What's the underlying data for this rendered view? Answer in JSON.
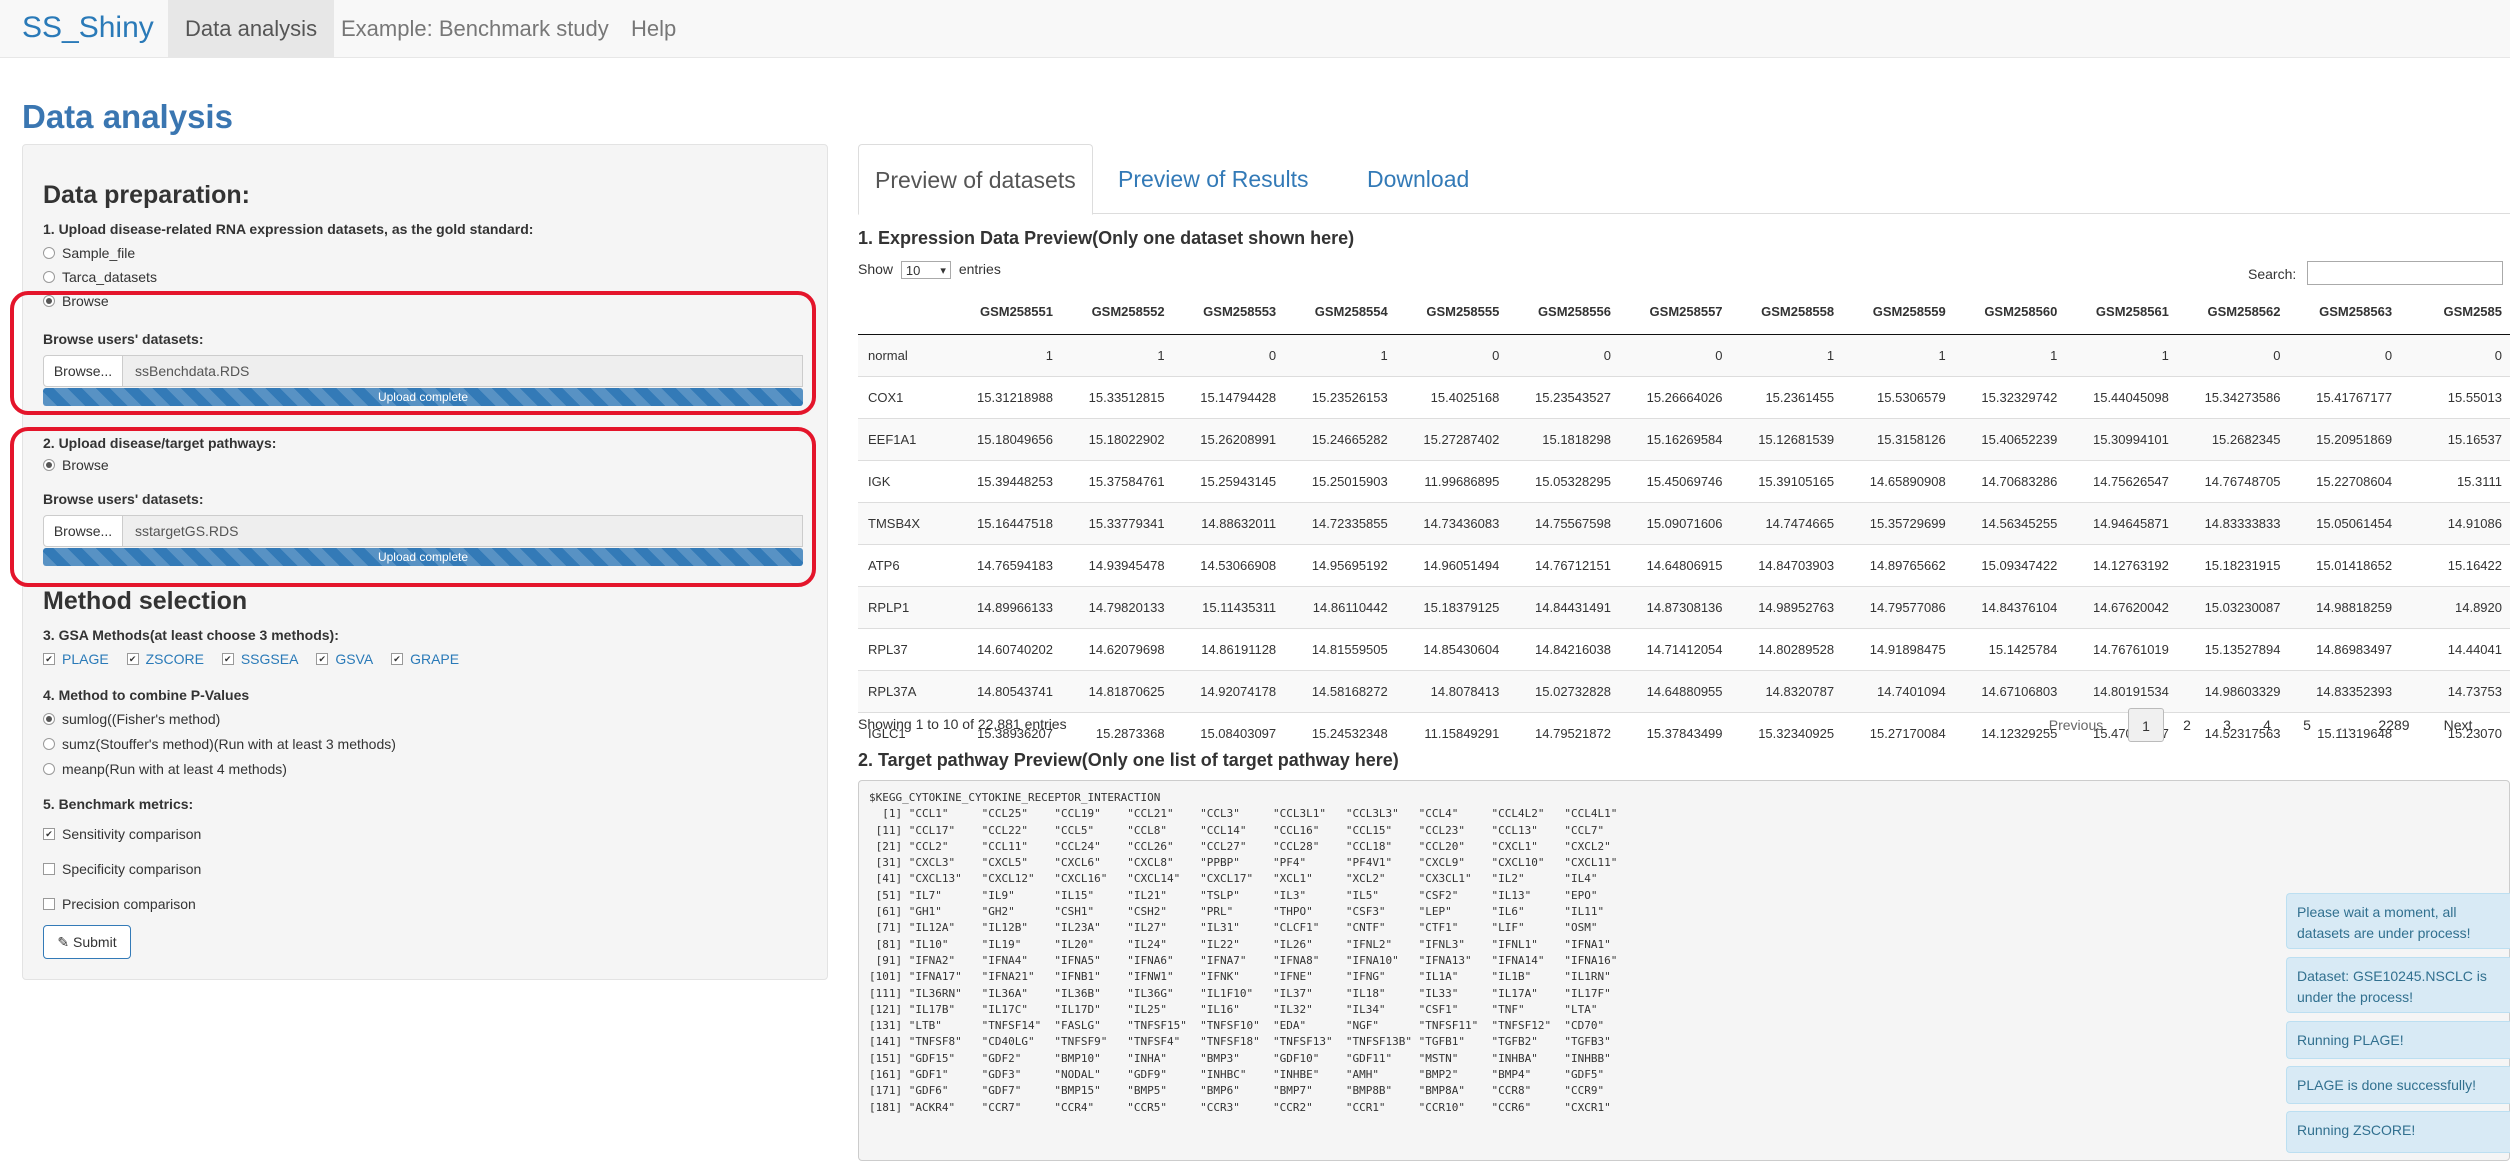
{
  "navbar": {
    "brand": "SS_Shiny",
    "items": [
      {
        "label": "Data analysis",
        "active": true
      },
      {
        "label": "Example: Benchmark study",
        "active": false
      },
      {
        "label": "Help",
        "active": false
      }
    ]
  },
  "page_title": "Data analysis",
  "sidebar": {
    "data_prep_title": "Data preparation:",
    "step1_label": "1. Upload disease-related RNA expression datasets, as the gold standard:",
    "step1_options": [
      {
        "label": "Sample_file",
        "selected": false
      },
      {
        "label": "Tarca_datasets",
        "selected": false
      },
      {
        "label": "Browse",
        "selected": true
      }
    ],
    "browse_users_datasets_1": "Browse users' datasets:",
    "browse_button_1": "Browse...",
    "file_name_1": "ssBenchdata.RDS",
    "upload_status_1": "Upload complete",
    "step2_label": "2. Upload disease/target pathways:",
    "step2_option": {
      "label": "Browse",
      "selected": true
    },
    "browse_users_datasets_2": "Browse users' datasets:",
    "browse_button_2": "Browse...",
    "file_name_2": "sstargetGS.RDS",
    "upload_status_2": "Upload complete",
    "method_title": "Method selection",
    "step3_label": "3. GSA Methods(at least choose 3 methods):",
    "gsa_methods": [
      {
        "label": "PLAGE",
        "checked": true
      },
      {
        "label": "ZSCORE",
        "checked": true
      },
      {
        "label": "SSGSEA",
        "checked": true
      },
      {
        "label": "GSVA",
        "checked": true
      },
      {
        "label": "GRAPE",
        "checked": true
      }
    ],
    "step4_label": "4. Method to combine P-Values",
    "combine_options": [
      {
        "label": "sumlog((Fisher's method)",
        "selected": true
      },
      {
        "label": "sumz(Stouffer's method)(Run with at least 3 methods)",
        "selected": false
      },
      {
        "label": "meanp(Run with at least 4 methods)",
        "selected": false
      }
    ],
    "step5_label": "5. Benchmark metrics:",
    "metrics": [
      {
        "label": "Sensitivity comparison",
        "checked": true
      },
      {
        "label": "Specificity comparison",
        "checked": false
      },
      {
        "label": "Precision comparison",
        "checked": false
      }
    ],
    "submit_label": "Submit"
  },
  "tabs": [
    {
      "label": "Preview of datasets",
      "active": true
    },
    {
      "label": "Preview of Results",
      "active": false
    },
    {
      "label": "Download",
      "active": false
    }
  ],
  "expression": {
    "title": "1. Expression Data Preview(Only one dataset shown here)",
    "show_label": "Show",
    "entries_value": "10",
    "entries_label": "entries",
    "search_label": "Search:",
    "columns": [
      "",
      "GSM258551",
      "GSM258552",
      "GSM258553",
      "GSM258554",
      "GSM258555",
      "GSM258556",
      "GSM258557",
      "GSM258558",
      "GSM258559",
      "GSM258560",
      "GSM258561",
      "GSM258562",
      "GSM258563",
      "GSM2585"
    ],
    "rows": [
      [
        "normal",
        "1",
        "1",
        "0",
        "1",
        "0",
        "0",
        "0",
        "1",
        "1",
        "1",
        "1",
        "0",
        "0",
        "0"
      ],
      [
        "COX1",
        "15.31218988",
        "15.33512815",
        "15.14794428",
        "15.23526153",
        "15.4025168",
        "15.23543527",
        "15.26664026",
        "15.2361455",
        "15.5306579",
        "15.32329742",
        "15.44045098",
        "15.34273586",
        "15.41767177",
        "15.55013"
      ],
      [
        "EEF1A1",
        "15.18049656",
        "15.18022902",
        "15.26208991",
        "15.24665282",
        "15.27287402",
        "15.1818298",
        "15.16269584",
        "15.12681539",
        "15.3158126",
        "15.40652239",
        "15.30994101",
        "15.2682345",
        "15.20951869",
        "15.16537"
      ],
      [
        "IGK",
        "15.39448253",
        "15.37584761",
        "15.25943145",
        "15.25015903",
        "11.99686895",
        "15.05328295",
        "15.45069746",
        "15.39105165",
        "14.65890908",
        "14.70683286",
        "14.75626547",
        "14.76748705",
        "15.22708604",
        "15.3111"
      ],
      [
        "TMSB4X",
        "15.16447518",
        "15.33779341",
        "14.88632011",
        "14.72335855",
        "14.73436083",
        "14.75567598",
        "15.09071606",
        "14.7474665",
        "15.35729699",
        "14.56345255",
        "14.94645871",
        "14.83333833",
        "15.05061454",
        "14.91086"
      ],
      [
        "ATP6",
        "14.76594183",
        "14.93945478",
        "14.53066908",
        "14.95695192",
        "14.96051494",
        "14.76712151",
        "14.64806915",
        "14.84703903",
        "14.89765662",
        "15.09347422",
        "14.12763192",
        "15.18231915",
        "15.01418652",
        "15.16422"
      ],
      [
        "RPLP1",
        "14.89966133",
        "14.79820133",
        "15.11435311",
        "14.86110442",
        "15.18379125",
        "14.84431491",
        "14.87308136",
        "14.98952763",
        "14.79577086",
        "14.84376104",
        "14.67620042",
        "15.03230087",
        "14.98818259",
        "14.8920"
      ],
      [
        "RPL37",
        "14.60740202",
        "14.62079698",
        "14.86191128",
        "14.81559505",
        "14.85430604",
        "14.84216038",
        "14.71412054",
        "14.80289528",
        "14.91898475",
        "15.1425784",
        "14.76761019",
        "15.13527894",
        "14.86983497",
        "14.44041"
      ],
      [
        "RPL37A",
        "14.80543741",
        "14.81870625",
        "14.92074178",
        "14.58168272",
        "14.8078413",
        "15.02732828",
        "14.64880955",
        "14.8320787",
        "14.7401094",
        "14.67106803",
        "14.80191534",
        "14.98603329",
        "14.83352393",
        "14.73753"
      ],
      [
        "IGLC1",
        "15.38936207",
        "15.2873368",
        "15.08403097",
        "15.24532348",
        "11.15849291",
        "14.79521872",
        "15.37843499",
        "15.32340925",
        "15.27170084",
        "14.12329255",
        "15.47090507",
        "14.52317563",
        "15.11319648",
        "15.23070"
      ]
    ],
    "info": "Showing 1 to 10 of 22,881 entries",
    "pagination": {
      "previous": "Previous",
      "pages": [
        "1",
        "2",
        "3",
        "4",
        "5",
        "…",
        "2289"
      ],
      "current": "1",
      "next": "Next"
    }
  },
  "pathway": {
    "title": "2. Target pathway Preview(Only one list of target pathway here)",
    "header": "$KEGG_CYTOKINE_CYTOKINE_RECEPTOR_INTERACTION",
    "lines": [
      "  [1] \"CCL1\"     \"CCL25\"    \"CCL19\"    \"CCL21\"    \"CCL3\"     \"CCL3L1\"   \"CCL3L3\"   \"CCL4\"     \"CCL4L2\"   \"CCL4L1\"",
      " [11] \"CCL17\"    \"CCL22\"    \"CCL5\"     \"CCL8\"     \"CCL14\"    \"CCL16\"    \"CCL15\"    \"CCL23\"    \"CCL13\"    \"CCL7\"",
      " [21] \"CCL2\"     \"CCL11\"    \"CCL24\"    \"CCL26\"    \"CCL27\"    \"CCL28\"    \"CCL18\"    \"CCL20\"    \"CXCL1\"    \"CXCL2\"",
      " [31] \"CXCL3\"    \"CXCL5\"    \"CXCL6\"    \"CXCL8\"    \"PPBP\"     \"PF4\"      \"PF4V1\"    \"CXCL9\"    \"CXCL10\"   \"CXCL11\"",
      " [41] \"CXCL13\"   \"CXCL12\"   \"CXCL16\"   \"CXCL14\"   \"CXCL17\"   \"XCL1\"     \"XCL2\"     \"CX3CL1\"   \"IL2\"      \"IL4\"",
      " [51] \"IL7\"      \"IL9\"      \"IL15\"     \"IL21\"     \"TSLP\"     \"IL3\"      \"IL5\"      \"CSF2\"     \"IL13\"     \"EPO\"",
      " [61] \"GH1\"      \"GH2\"      \"CSH1\"     \"CSH2\"     \"PRL\"      \"THPO\"     \"CSF3\"     \"LEP\"      \"IL6\"      \"IL11\"",
      " [71] \"IL12A\"    \"IL12B\"    \"IL23A\"    \"IL27\"     \"IL31\"     \"CLCF1\"    \"CNTF\"     \"CTF1\"     \"LIF\"      \"OSM\"",
      " [81] \"IL10\"     \"IL19\"     \"IL20\"     \"IL24\"     \"IL22\"     \"IL26\"     \"IFNL2\"    \"IFNL3\"    \"IFNL1\"    \"IFNA1\"",
      " [91] \"IFNA2\"    \"IFNA4\"    \"IFNA5\"    \"IFNA6\"    \"IFNA7\"    \"IFNA8\"    \"IFNA10\"   \"IFNA13\"   \"IFNA14\"   \"IFNA16\"",
      "[101] \"IFNA17\"   \"IFNA21\"   \"IFNB1\"    \"IFNW1\"    \"IFNK\"     \"IFNE\"     \"IFNG\"     \"IL1A\"     \"IL1B\"     \"IL1RN\"",
      "[111] \"IL36RN\"   \"IL36A\"    \"IL36B\"    \"IL36G\"    \"IL1F10\"   \"IL37\"     \"IL18\"     \"IL33\"     \"IL17A\"    \"IL17F\"",
      "[121] \"IL17B\"    \"IL17C\"    \"IL17D\"    \"IL25\"     \"IL16\"     \"IL32\"     \"IL34\"     \"CSF1\"     \"TNF\"      \"LTA\"",
      "[131] \"LTB\"      \"TNFSF14\"  \"FASLG\"    \"TNFSF15\"  \"TNFSF10\"  \"EDA\"      \"NGF\"      \"TNFSF11\"  \"TNFSF12\"  \"CD70\"",
      "[141] \"TNFSF8\"   \"CD40LG\"   \"TNFSF9\"   \"TNFSF4\"   \"TNFSF18\"  \"TNFSF13\"  \"TNFSF13B\" \"TGFB1\"    \"TGFB2\"    \"TGFB3\"",
      "[151] \"GDF15\"    \"GDF2\"     \"BMP10\"    \"INHA\"     \"BMP3\"     \"GDF10\"    \"GDF11\"    \"MSTN\"     \"INHBA\"    \"INHBB\"",
      "[161] \"GDF1\"     \"GDF3\"     \"NODAL\"    \"GDF9\"     \"INHBC\"    \"INHBE\"    \"AMH\"      \"BMP2\"     \"BMP4\"     \"GDF5\"",
      "[171] \"GDF6\"     \"GDF7\"     \"BMP15\"    \"BMP5\"     \"BMP6\"     \"BMP7\"     \"BMP8B\"    \"BMP8A\"    \"CCR8\"     \"CCR9\"",
      "[181] \"ACKR4\"    \"CCR7\"     \"CCR4\"     \"CCR5\"     \"CCR3\"     \"CCR2\"     \"CCR1\"     \"CCR10\"    \"CCR6\"     \"CXCR1\""
    ]
  },
  "notifications": [
    "Please wait a moment, all datasets are under process!",
    "Dataset: GSE10245.NSCLC is under the process!",
    "Running PLAGE!",
    "PLAGE is done successfully!",
    "Running ZSCORE!"
  ],
  "colors": {
    "brand": "#2a7ab8",
    "highlight_border": "#e4152b",
    "progress": "#337ab7",
    "notification_bg": "#d8eaf5"
  }
}
